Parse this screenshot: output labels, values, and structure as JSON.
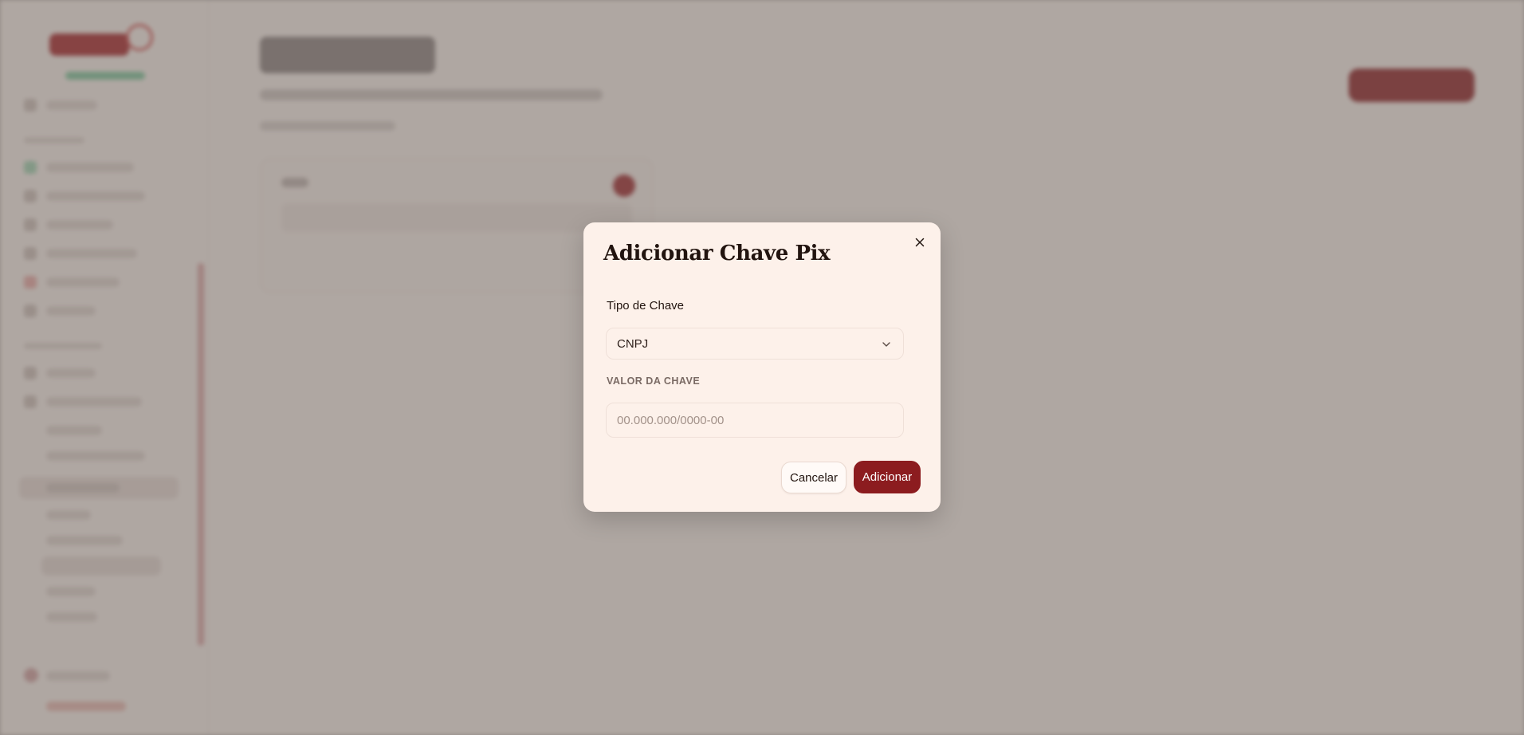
{
  "modal": {
    "title": "Adicionar Chave Pix",
    "key_type_label": "Tipo de Chave",
    "key_type_value": "CNPJ",
    "key_value_label": "VALOR DA CHAVE",
    "key_value_placeholder": "00.000.000/0000-00",
    "key_value": "",
    "cancel_label": "Cancelar",
    "submit_label": "Adicionar"
  },
  "colors": {
    "accent": "#8c1c1f",
    "modal_bg": "#fdf1ea",
    "overlay": "#68605c"
  },
  "icons": {
    "close": "close-icon",
    "select": "chevron-down-icon"
  }
}
